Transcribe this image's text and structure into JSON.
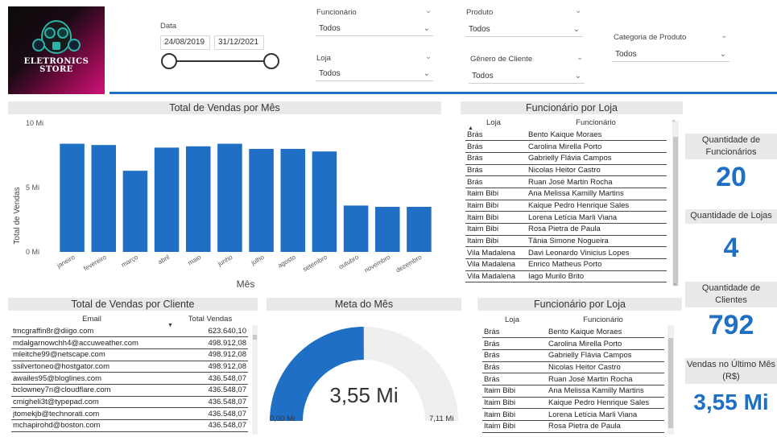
{
  "logo": {
    "line1": "ELETRONICS",
    "line2": "STORE"
  },
  "filters": {
    "data_label": "Data",
    "date_start": "24/08/2019",
    "date_end": "31/12/2021",
    "funcionario_label": "Funcionário",
    "funcionario_value": "Todos",
    "loja_label": "Loja",
    "loja_value": "Todos",
    "produto_label": "Produto",
    "produto_value": "Todos",
    "genero_label": "Gênero de Cliente",
    "genero_value": "Todos",
    "categoria_label": "Categoria de Produto",
    "categoria_value": "Todos"
  },
  "chart_data": {
    "type": "bar",
    "title": "Total de Vendas por Mês",
    "xlabel": "Mês",
    "ylabel": "Total de Vendas",
    "categories": [
      "janeiro",
      "fevereiro",
      "março",
      "abril",
      "maio",
      "junho",
      "julho",
      "agosto",
      "setembro",
      "outubro",
      "novembro",
      "dezembro"
    ],
    "values": [
      8.4,
      8.3,
      6.3,
      8.1,
      8.2,
      8.4,
      8.0,
      8.0,
      7.8,
      3.6,
      3.5,
      3.5
    ],
    "ylim": [
      0,
      10
    ],
    "yticks": [
      "0 Mi",
      "5 Mi",
      "10 Mi"
    ],
    "ytick_values": [
      0,
      5,
      10
    ],
    "color": "#1f6fc5"
  },
  "func_loja_top": {
    "title": "Funcionário por Loja",
    "col_loja": "Loja",
    "col_func": "Funcionário",
    "rows": [
      [
        "Brás",
        "Bento Kaique Moraes"
      ],
      [
        "Brás",
        "Carolina Mirella Porto"
      ],
      [
        "Brás",
        "Gabrielly Flávia Campos"
      ],
      [
        "Brás",
        "Nicolas Heitor Castro"
      ],
      [
        "Brás",
        "Ruan José Martin Rocha"
      ],
      [
        "Itaim Bibi",
        "Ana Melissa Kamilly Martins"
      ],
      [
        "Itaim Bibi",
        "Kaique Pedro Henrique Sales"
      ],
      [
        "Itaim Bibi",
        "Lorena Letícia Marli Viana"
      ],
      [
        "Itaim Bibi",
        "Rosa Pietra de Paula"
      ],
      [
        "Itaim Bibi",
        "Tânia Simone Nogueira"
      ],
      [
        "Vila Madalena",
        "Davi Leonardo Vinicius Lopes"
      ],
      [
        "Vila Madalena",
        "Enrico Matheus Porto"
      ],
      [
        "Vila Madalena",
        "Iago Murilo Brito"
      ]
    ]
  },
  "cards": {
    "funcionarios_title": "Quantidade de Funcionários",
    "funcionarios_value": "20",
    "lojas_title": "Quantidade de Lojas",
    "lojas_value": "4",
    "clientes_title": "Quantidade de Clientes",
    "clientes_value": "792",
    "vendas_title": "Vendas no Último Mês (R$)",
    "vendas_value": "3,55 Mi"
  },
  "clientes": {
    "title": "Total de Vendas por Cliente",
    "col_email": "Email",
    "col_total": "Total Vendas",
    "rows": [
      [
        "tmcgraffin8r@diigo.com",
        "623.640,10"
      ],
      [
        "mdalgarnowchh4@accuweather.com",
        "498.912,08"
      ],
      [
        "mleitche99@netscape.com",
        "498.912,08"
      ],
      [
        "ssilvertoneo@hostgator.com",
        "498.912,08"
      ],
      [
        "awailes95@bloglines.com",
        "436.548,07"
      ],
      [
        "bclowney7n@cloudflare.com",
        "436.548,07"
      ],
      [
        "cmigheli3t@typepad.com",
        "436.548,07"
      ],
      [
        "jtomekjb@technorati.com",
        "436.548,07"
      ],
      [
        "mchapirohd@boston.com",
        "436.548,07"
      ]
    ]
  },
  "meta": {
    "title": "Meta do Mês",
    "value_label": "3,55 Mi",
    "min_label": "0,00 Mi",
    "max_label": "7,11 Mi",
    "value": 3.55,
    "min": 0,
    "max": 7.11,
    "fill_color": "#1f6fc5",
    "track_color": "#efefef"
  },
  "func_loja_bottom": {
    "title": "Funcionário por Loja",
    "col_loja": "Loja",
    "col_func": "Funcionário",
    "rows": [
      [
        "Brás",
        "Bento Kaique Moraes"
      ],
      [
        "Brás",
        "Carolina Mirella Porto"
      ],
      [
        "Brás",
        "Gabrielly Flávia Campos"
      ],
      [
        "Brás",
        "Nicolas Heitor Castro"
      ],
      [
        "Brás",
        "Ruan José Martin Rocha"
      ],
      [
        "Itaim Bibi",
        "Ana Melissa Kamilly Martins"
      ],
      [
        "Itaim Bibi",
        "Kaique Pedro Henrique Sales"
      ],
      [
        "Itaim Bibi",
        "Lorena Letícia Marli Viana"
      ],
      [
        "Itaim Bibi",
        "Rosa Pietra de Paula"
      ]
    ]
  }
}
